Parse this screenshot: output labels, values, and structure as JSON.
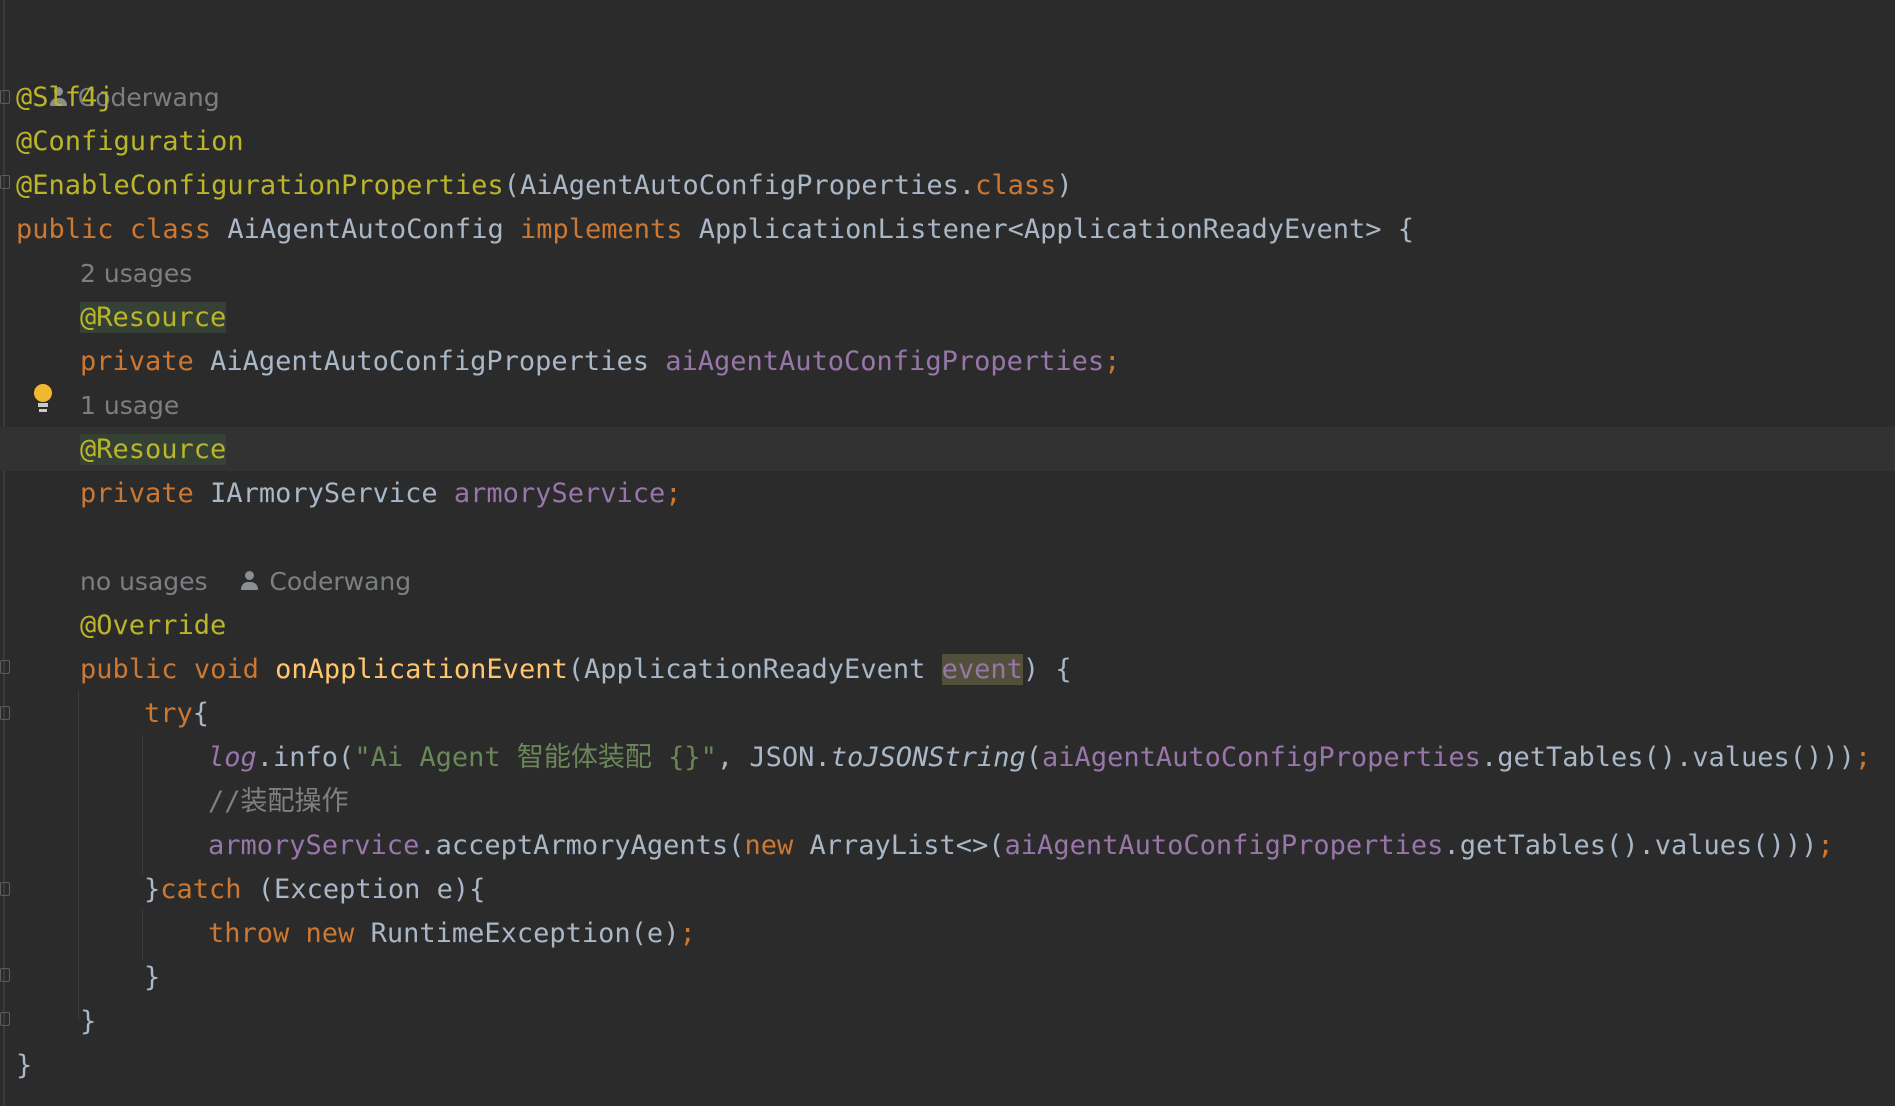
{
  "hints": {
    "author_top": "Coderwang",
    "usages_2": "2 usages",
    "usages_1": "1 usage",
    "no_usages": "no usages",
    "author_method": "Coderwang"
  },
  "code": {
    "slf4j": "@Slf4j",
    "configuration": "@Configuration",
    "enable_props": "@EnableConfigurationProperties",
    "enable_props_paren_open": "(",
    "enable_props_class_name": "AiAgentAutoConfigProperties.",
    "class_kw_suffix": "class",
    "enable_props_paren_close": ")",
    "public": "public",
    "class": "class",
    "class_name": "AiAgentAutoConfig",
    "implements": "implements",
    "listener_type": "ApplicationListener<ApplicationReadyEvent> {",
    "resource": "@Resource",
    "private": "private",
    "props_type": "AiAgentAutoConfigProperties",
    "props_field": "aiAgentAutoConfigProperties",
    "semicolon": ";",
    "armory_type": "IArmoryService",
    "armory_field": "armoryService",
    "override": "@Override",
    "void": "void",
    "method_name": "onApplicationEvent",
    "param_open": "(ApplicationReadyEvent ",
    "param_name": "event",
    "param_close": ") {",
    "try": "try",
    "open_brace": "{",
    "log": "log",
    "info_call": ".info(",
    "log_string": "\"Ai Agent 智能体装配 {}\"",
    "json_prefix": ", JSON.",
    "to_json": "toJSONString",
    "paren_open": "(",
    "get_tables_values": ".getTables().values()));",
    "get_tables_values_end": ".getTables().values()))",
    "comment": "//装配操作",
    "accept_call": ".acceptArmoryAgents(",
    "new": "new",
    "array_list": " ArrayList<>(",
    "close_try": "}",
    "catch": "catch",
    "catch_params": " (Exception e){",
    "throw": "throw",
    "runtime_ex": "RuntimeException(e)",
    "close_inner": "}",
    "close_method": "}",
    "close_class": "}"
  },
  "colors": {
    "background": "#2b2b2b",
    "keyword": "#cc7832",
    "annotation": "#bbb529",
    "method": "#ffc66d",
    "field": "#9876aa",
    "string": "#6a8759",
    "comment": "#808080",
    "text": "#a9b7c6"
  },
  "icons": {
    "author": "person-icon",
    "intention": "lightbulb-icon"
  }
}
